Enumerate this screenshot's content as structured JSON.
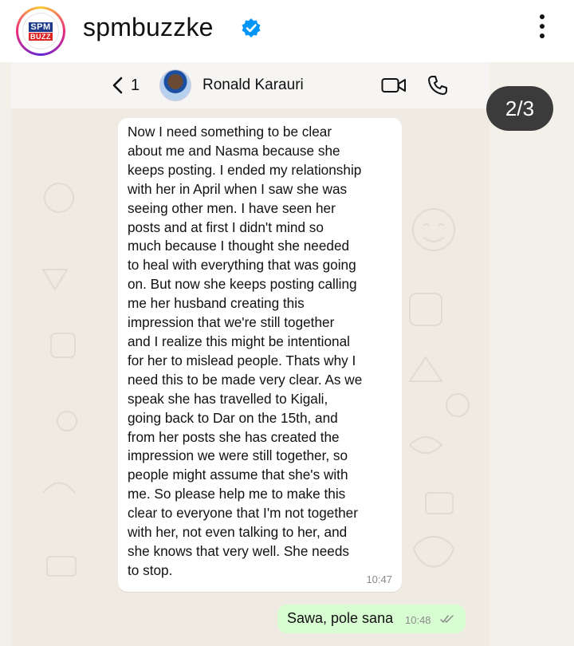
{
  "instagram": {
    "username": "spmbuzzke",
    "logo_top": "SPM",
    "logo_bottom": "BUZZ",
    "verified_icon": "verified-badge-icon",
    "more_icon": "more-vertical-icon"
  },
  "post": {
    "pager": "2/3"
  },
  "whatsapp": {
    "back_count": "1",
    "contact_name": "Ronald Karauri",
    "icons": [
      "back-icon",
      "video-call-icon",
      "phone-call-icon"
    ],
    "incoming_message": {
      "text": "Now I need something to be clear\nabout me and Nasma because she\nkeeps posting. I ended my relationship\nwith her in April when I saw she was\nseeing other men. I have seen her\nposts and at first I didn't mind so\nmuch because I thought she needed\nto heal with everything that was going\non. But now she keeps posting calling\nme her husband creating this\nimpression that we're still together\nand I realize this might be intentional\nfor her to mislead people. Thats why I\nneed this to be made very clear. As we\nspeak she has travelled to Kigali,\ngoing back to Dar on the 15th, and\nfrom her posts she has created the\nimpression we were still together, so\npeople might assume that she's with\nme. So please help me to make this\nclear to everyone that I'm not together\nwith her, not even talking to her, and\nshe knows that very well. She needs\nto stop.",
      "time": "10:47"
    },
    "outgoing_message": {
      "text": "Sawa, pole sana",
      "time": "10:48",
      "status_icon": "double-check-icon"
    }
  },
  "colors": {
    "chat_background": "#efeae2",
    "outgoing_bubble": "#d9fdd3",
    "incoming_bubble": "#ffffff",
    "verified_blue": "#0095f6",
    "pager_background": "#3b3b3b"
  }
}
